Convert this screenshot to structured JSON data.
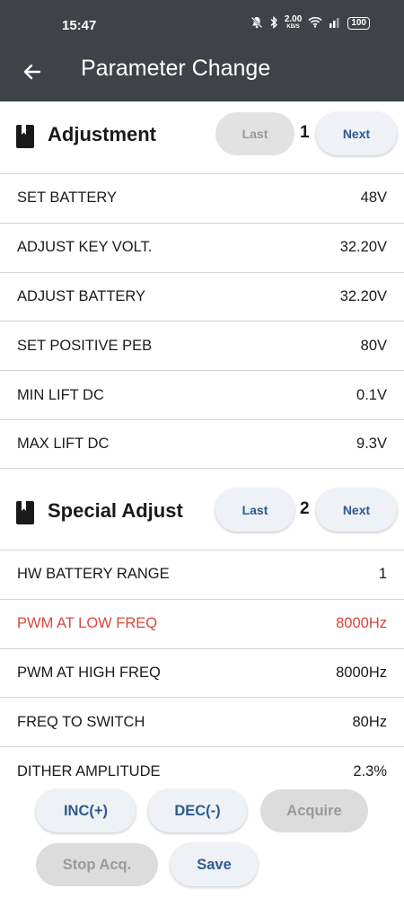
{
  "status_bar": {
    "time": "15:47",
    "net_speed": "2.00",
    "net_unit": "KB/S",
    "battery": "100",
    "icons": [
      "bell-off-icon",
      "bluetooth-icon",
      "wifi-icon",
      "signal-icon",
      "battery-icon"
    ]
  },
  "app_bar": {
    "title": "Parameter Change",
    "back_icon": "arrow-left-icon"
  },
  "sections": [
    {
      "title": "Adjustment",
      "icon": "book-icon",
      "last_label": "Last",
      "last_enabled": false,
      "page": "1",
      "next_label": "Next",
      "rows": [
        {
          "name": "SET BATTERY",
          "value": "48V"
        },
        {
          "name": "ADJUST KEY VOLT.",
          "value": "32.20V"
        },
        {
          "name": "ADJUST BATTERY",
          "value": "32.20V"
        },
        {
          "name": "SET POSITIVE PEB",
          "value": "80V"
        },
        {
          "name": "MIN LIFT  DC",
          "value": "0.1V"
        },
        {
          "name": "MAX LIFT  DC",
          "value": "9.3V"
        }
      ]
    },
    {
      "title": "Special Adjust",
      "icon": "book-icon",
      "last_label": "Last",
      "last_enabled": true,
      "page": "2",
      "next_label": "Next",
      "rows": [
        {
          "name": "HW BATTERY RANGE",
          "value": "1"
        },
        {
          "name": "PWM AT LOW FREQ",
          "value": "8000Hz",
          "highlight": true
        },
        {
          "name": "PWM AT HIGH FREQ",
          "value": "8000Hz"
        },
        {
          "name": "FREQ TO SWITCH",
          "value": "80Hz"
        },
        {
          "name": "DITHER AMPLITUDE",
          "value": "2.3%"
        }
      ]
    }
  ],
  "actions": {
    "inc": {
      "label": "INC(+)",
      "enabled": true
    },
    "dec": {
      "label": "DEC(-)",
      "enabled": true
    },
    "acquire": {
      "label": "Acquire",
      "enabled": false
    },
    "stop_acq": {
      "label": "Stop Acq.",
      "enabled": false
    },
    "save": {
      "label": "Save",
      "enabled": true
    }
  },
  "colors": {
    "bar_background": "#3f4347",
    "button_text": "#2e5b8f",
    "highlight_text": "#d9483b",
    "disabled_text": "#9a9a9a"
  }
}
